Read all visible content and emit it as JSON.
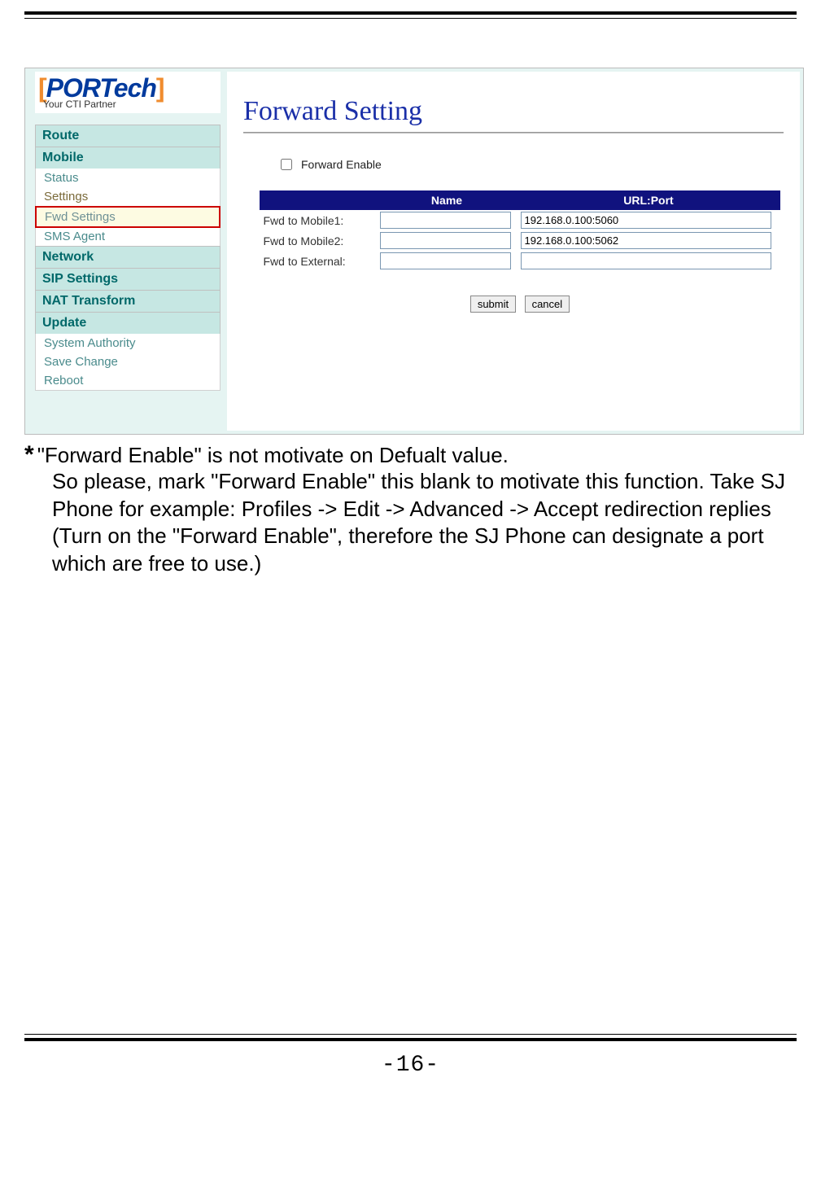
{
  "logo": {
    "brackets_open": "[",
    "text": "PORTech",
    "brackets_close": "]",
    "tagline": "Your CTI Partner"
  },
  "nav": {
    "route": "Route",
    "mobile": "Mobile",
    "mobile_sub": {
      "status": "Status",
      "settings": "Settings",
      "fwd": "Fwd Settings",
      "sms": "SMS Agent"
    },
    "network": "Network",
    "sip": "SIP Settings",
    "nat": "NAT Transform",
    "update": "Update",
    "update_sub": {
      "auth": "System Authority",
      "save": "Save Change",
      "reboot": "Reboot"
    }
  },
  "content": {
    "title": "Forward Setting",
    "enable_label": "Forward Enable",
    "headers": {
      "blank": "",
      "name": "Name",
      "url": "URL:Port"
    },
    "rows": [
      {
        "label": "Fwd to Mobile1:",
        "name": "",
        "url": "192.168.0.100:5060"
      },
      {
        "label": "Fwd to Mobile2:",
        "name": "",
        "url": "192.168.0.100:5062"
      },
      {
        "label": "Fwd to External:",
        "name": "",
        "url": ""
      }
    ],
    "buttons": {
      "submit": "submit",
      "cancel": "cancel"
    }
  },
  "note": {
    "asterisk": "*",
    "line1": "\"Forward Enable\" is not motivate on Defualt value.",
    "rest": "So please, mark \"Forward Enable\" this blank to motivate this function. Take SJ Phone for example: Profiles -> Edit -> Advanced -> Accept redirection replies (Turn on the \"Forward Enable\", therefore the SJ Phone can designate a port which are free to use.)"
  },
  "page_number": "-16-"
}
